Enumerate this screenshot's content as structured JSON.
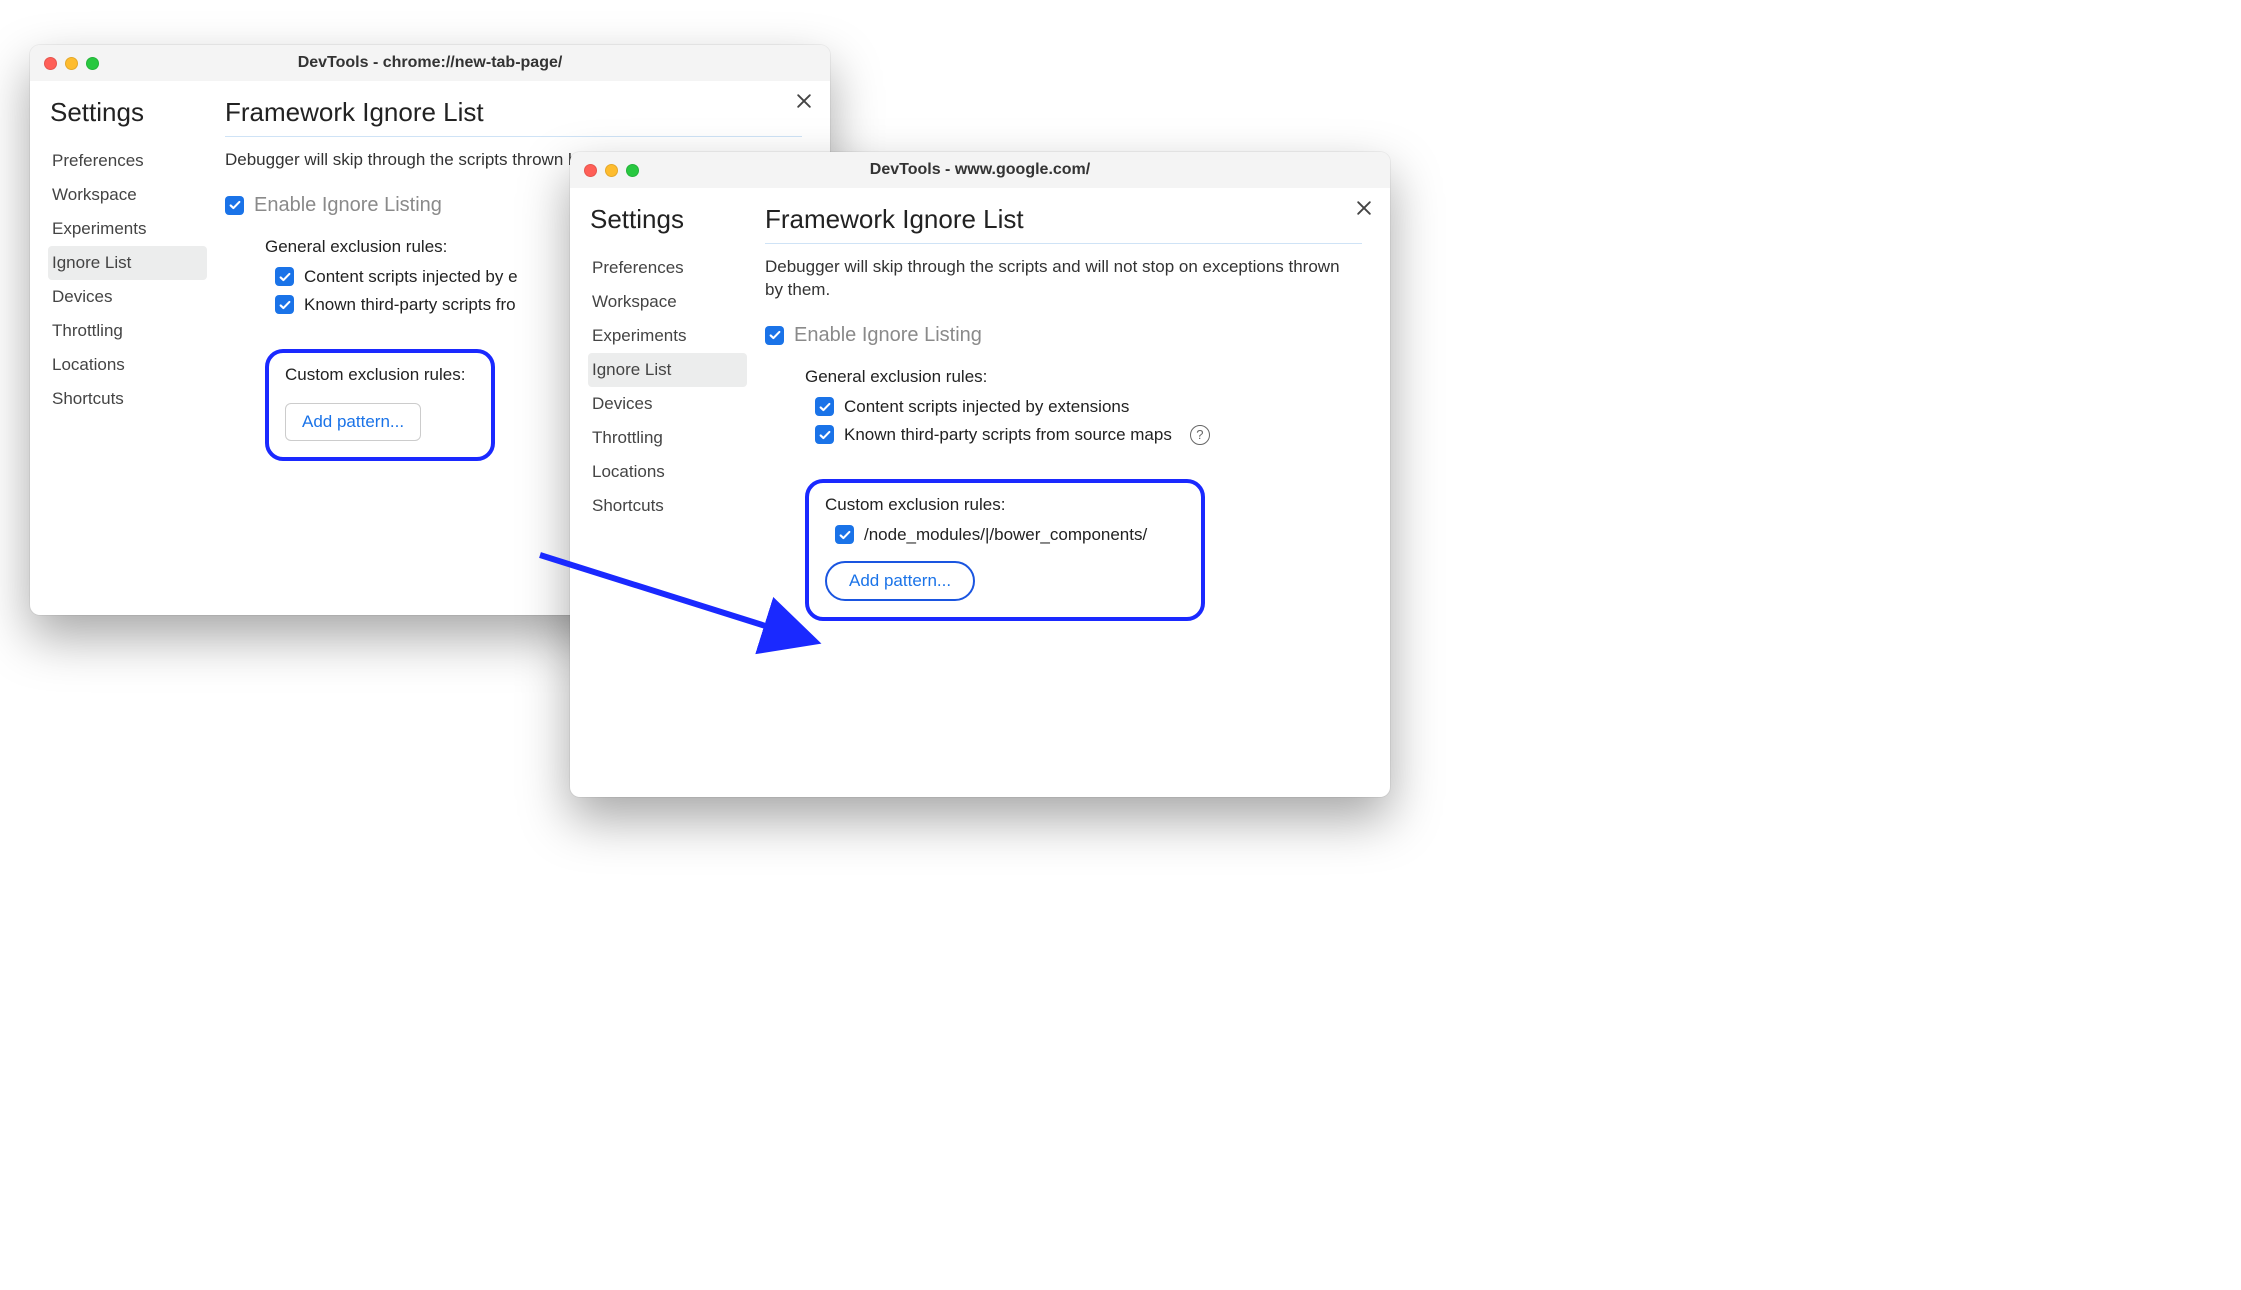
{
  "window1": {
    "title": "DevTools - chrome://new-tab-page/",
    "settings_heading": "Settings",
    "nav": [
      "Preferences",
      "Workspace",
      "Experiments",
      "Ignore List",
      "Devices",
      "Throttling",
      "Locations",
      "Shortcuts"
    ],
    "page_heading": "Framework Ignore List",
    "description_visible": "Debugger will skip through the scripts thrown by them.",
    "enable_label": "Enable Ignore Listing",
    "general_heading": "General exclusion rules:",
    "rule1_visible": "Content scripts injected by e",
    "rule2_visible": "Known third-party scripts fro",
    "custom_heading": "Custom exclusion rules:",
    "add_pattern": "Add pattern..."
  },
  "window2": {
    "title": "DevTools - www.google.com/",
    "settings_heading": "Settings",
    "nav": [
      "Preferences",
      "Workspace",
      "Experiments",
      "Ignore List",
      "Devices",
      "Throttling",
      "Locations",
      "Shortcuts"
    ],
    "page_heading": "Framework Ignore List",
    "description": "Debugger will skip through the scripts and will not stop on exceptions thrown by them.",
    "enable_label": "Enable Ignore Listing",
    "general_heading": "General exclusion rules:",
    "rule1": "Content scripts injected by extensions",
    "rule2": "Known third-party scripts from source maps",
    "custom_heading": "Custom exclusion rules:",
    "custom_pattern_1": "/node_modules/|/bower_components/",
    "add_pattern": "Add pattern..."
  }
}
